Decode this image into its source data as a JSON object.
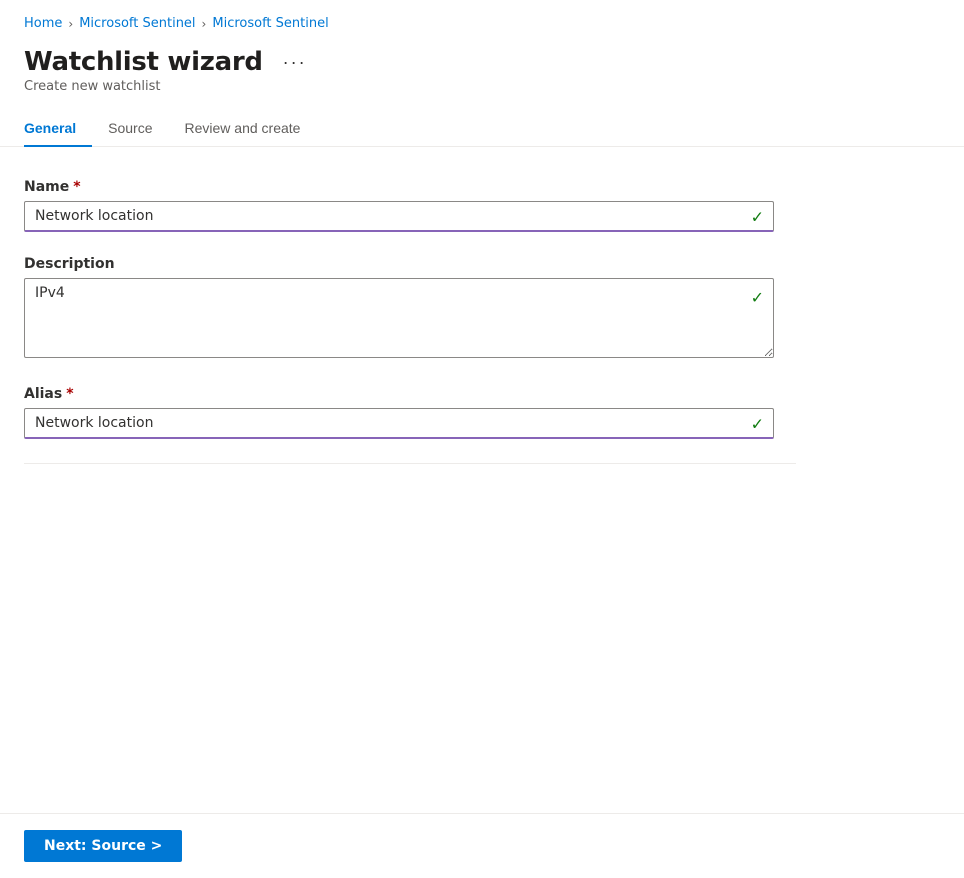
{
  "breadcrumb": {
    "items": [
      {
        "label": "Home",
        "href": "#"
      },
      {
        "label": "Microsoft Sentinel",
        "href": "#"
      },
      {
        "label": "Microsoft Sentinel",
        "href": "#"
      }
    ],
    "separators": [
      ">",
      ">",
      ">"
    ]
  },
  "page": {
    "title": "Watchlist wizard",
    "more_options_label": "···",
    "subtitle": "Create new watchlist"
  },
  "tabs": [
    {
      "id": "general",
      "label": "General",
      "active": true
    },
    {
      "id": "source",
      "label": "Source",
      "active": false
    },
    {
      "id": "review",
      "label": "Review and create",
      "active": false
    }
  ],
  "form": {
    "name_label": "Name",
    "name_required": "*",
    "name_value": "Network location",
    "description_label": "Description",
    "description_value": "IPv4",
    "alias_label": "Alias",
    "alias_required": "*",
    "alias_value": "Network location"
  },
  "footer": {
    "next_button_label": "Next: Source >"
  }
}
